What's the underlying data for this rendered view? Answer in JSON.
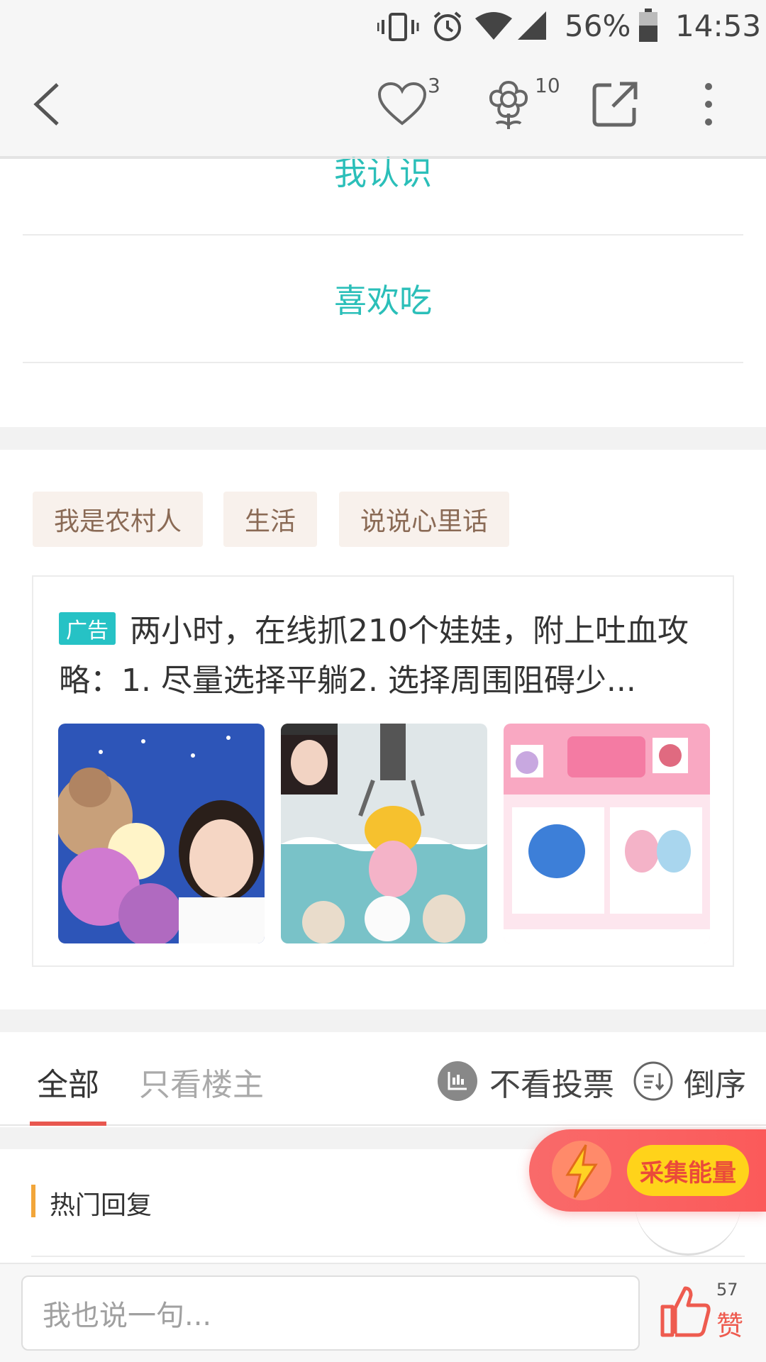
{
  "status_bar": {
    "battery": "56%",
    "time": "14:53"
  },
  "toolbar": {
    "like_count": "3",
    "flower_count": "10"
  },
  "vote_options": [
    {
      "label": "我认识"
    },
    {
      "label": "喜欢吃"
    }
  ],
  "tags": [
    {
      "label": "我是农村人"
    },
    {
      "label": "生活"
    },
    {
      "label": "说说心里话"
    }
  ],
  "ad": {
    "badge": "广告",
    "title": "两小时，在线抓210个娃娃，附上吐血攻略：1. 尽量选择平躺2. 选择周围阻碍少..."
  },
  "tabs": {
    "all": "全部",
    "owner_only": "只看楼主",
    "hide_votes": "不看投票",
    "reverse": "倒序"
  },
  "energy": {
    "label": "采集能量"
  },
  "hot_replies": {
    "title": "热门回复"
  },
  "bottom_bar": {
    "placeholder": "我也说一句...",
    "like_count": "57",
    "like_label": "赞"
  },
  "colors": {
    "teal": "#2bbfb9",
    "tab_underline": "#e8574f",
    "accent_orange": "#f2a63a",
    "like_red": "#ee5b4f"
  }
}
